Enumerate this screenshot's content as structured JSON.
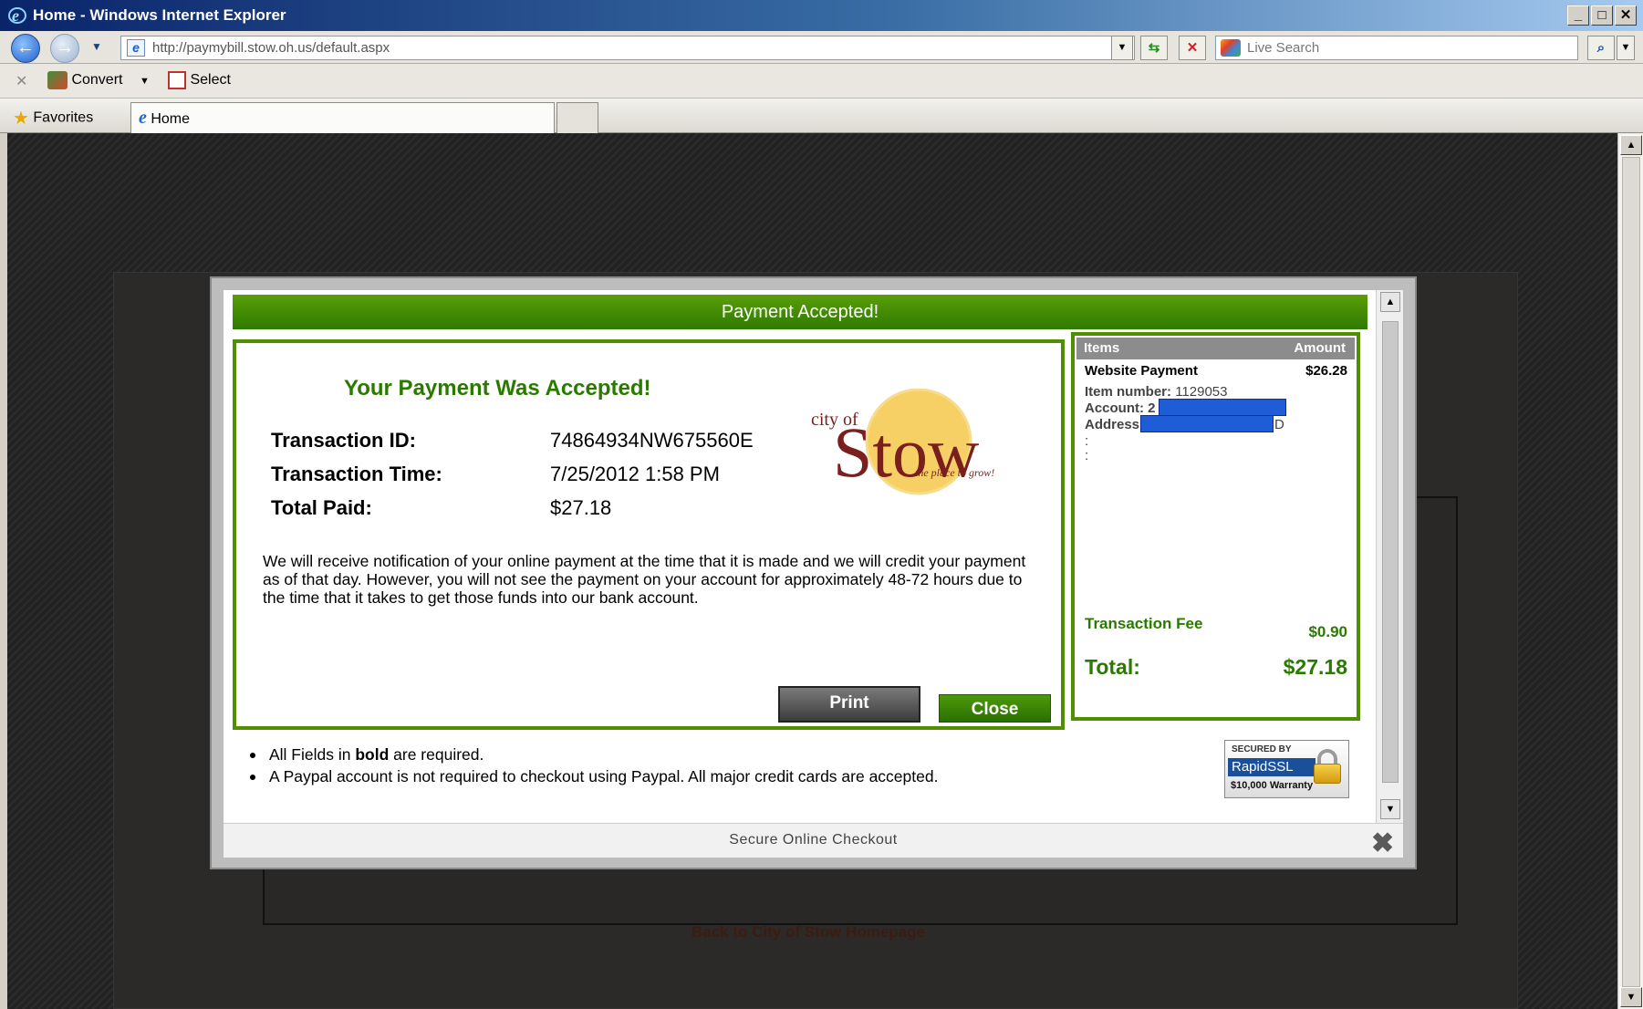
{
  "window": {
    "title": "Home - Windows Internet Explorer",
    "controls": [
      "_",
      "□",
      "✕"
    ]
  },
  "addressbar": {
    "url": "http://paymybill.stow.oh.us/default.aspx",
    "search_placeholder": "Live Search"
  },
  "command_bar": {
    "convert_label": "Convert",
    "select_label": "Select"
  },
  "favorites_bar": {
    "favorites_label": "Favorites",
    "tab_label": "Home"
  },
  "background_page": {
    "link_text": "Back to City of Stow Homepage"
  },
  "modal": {
    "header": "Payment Accepted!",
    "receipt_title": "Your Payment Was Accepted!",
    "transaction_id_label": "Transaction ID:",
    "transaction_id": "74864934NW675560E",
    "transaction_time_label": "Transaction Time:",
    "transaction_time": "7/25/2012 1:58 PM",
    "total_paid_label": "Total Paid:",
    "total_paid": "$27.18",
    "notice": "We will receive notification of your online payment at the time that it is made and we will credit your payment as of that day. However, you will not see the payment on your account for approximately 48-72 hours due to the time that it takes to get those funds into our bank account.",
    "print_label": "Print",
    "close_label": "Close",
    "logo": {
      "city_of": "city of",
      "name": "Stow",
      "tagline": "the place to grow!"
    },
    "summary": {
      "col_items": "Items",
      "col_amount": "Amount",
      "item_name": "Website Payment",
      "item_amount": "$26.28",
      "item_number_label": "Item number:",
      "item_number": "1129053",
      "account_label": "Account: 2",
      "address_label": "Address",
      "address_suffix": "D",
      "colon1": ":",
      "colon2": ":",
      "fee_label": "Transaction Fee",
      "fee_amount": "$0.90",
      "total_label": "Total:",
      "total_amount": "$27.18"
    },
    "bullets": {
      "b1_pre": "All Fields in ",
      "b1_bold": "bold",
      "b1_post": " are required.",
      "b2": "A Paypal account is not required to checkout using Paypal. All major credit cards are accepted."
    },
    "ssl_badge": {
      "secured_by": "SECURED BY",
      "brand": "RapidSSL",
      "warranty": "$10,000 Warranty"
    },
    "footer": "Secure Online Checkout"
  },
  "colors": {
    "accent_green": "#4f8f00",
    "title_green": "#2a7a00",
    "redaction_blue": "#1e5dd6",
    "stow_maroon": "#7a1e1e",
    "logo_sun": "#f4c84a"
  },
  "icons": [
    "ie-logo-icon",
    "back-arrow-icon",
    "forward-arrow-icon",
    "page-icon",
    "refresh-icon",
    "stop-icon",
    "live-search-icon",
    "search-icon",
    "close-x-icon",
    "convert-icon",
    "select-icon",
    "favorites-star-icon",
    "tab-ie-icon",
    "lock-icon",
    "modal-close-icon"
  ]
}
